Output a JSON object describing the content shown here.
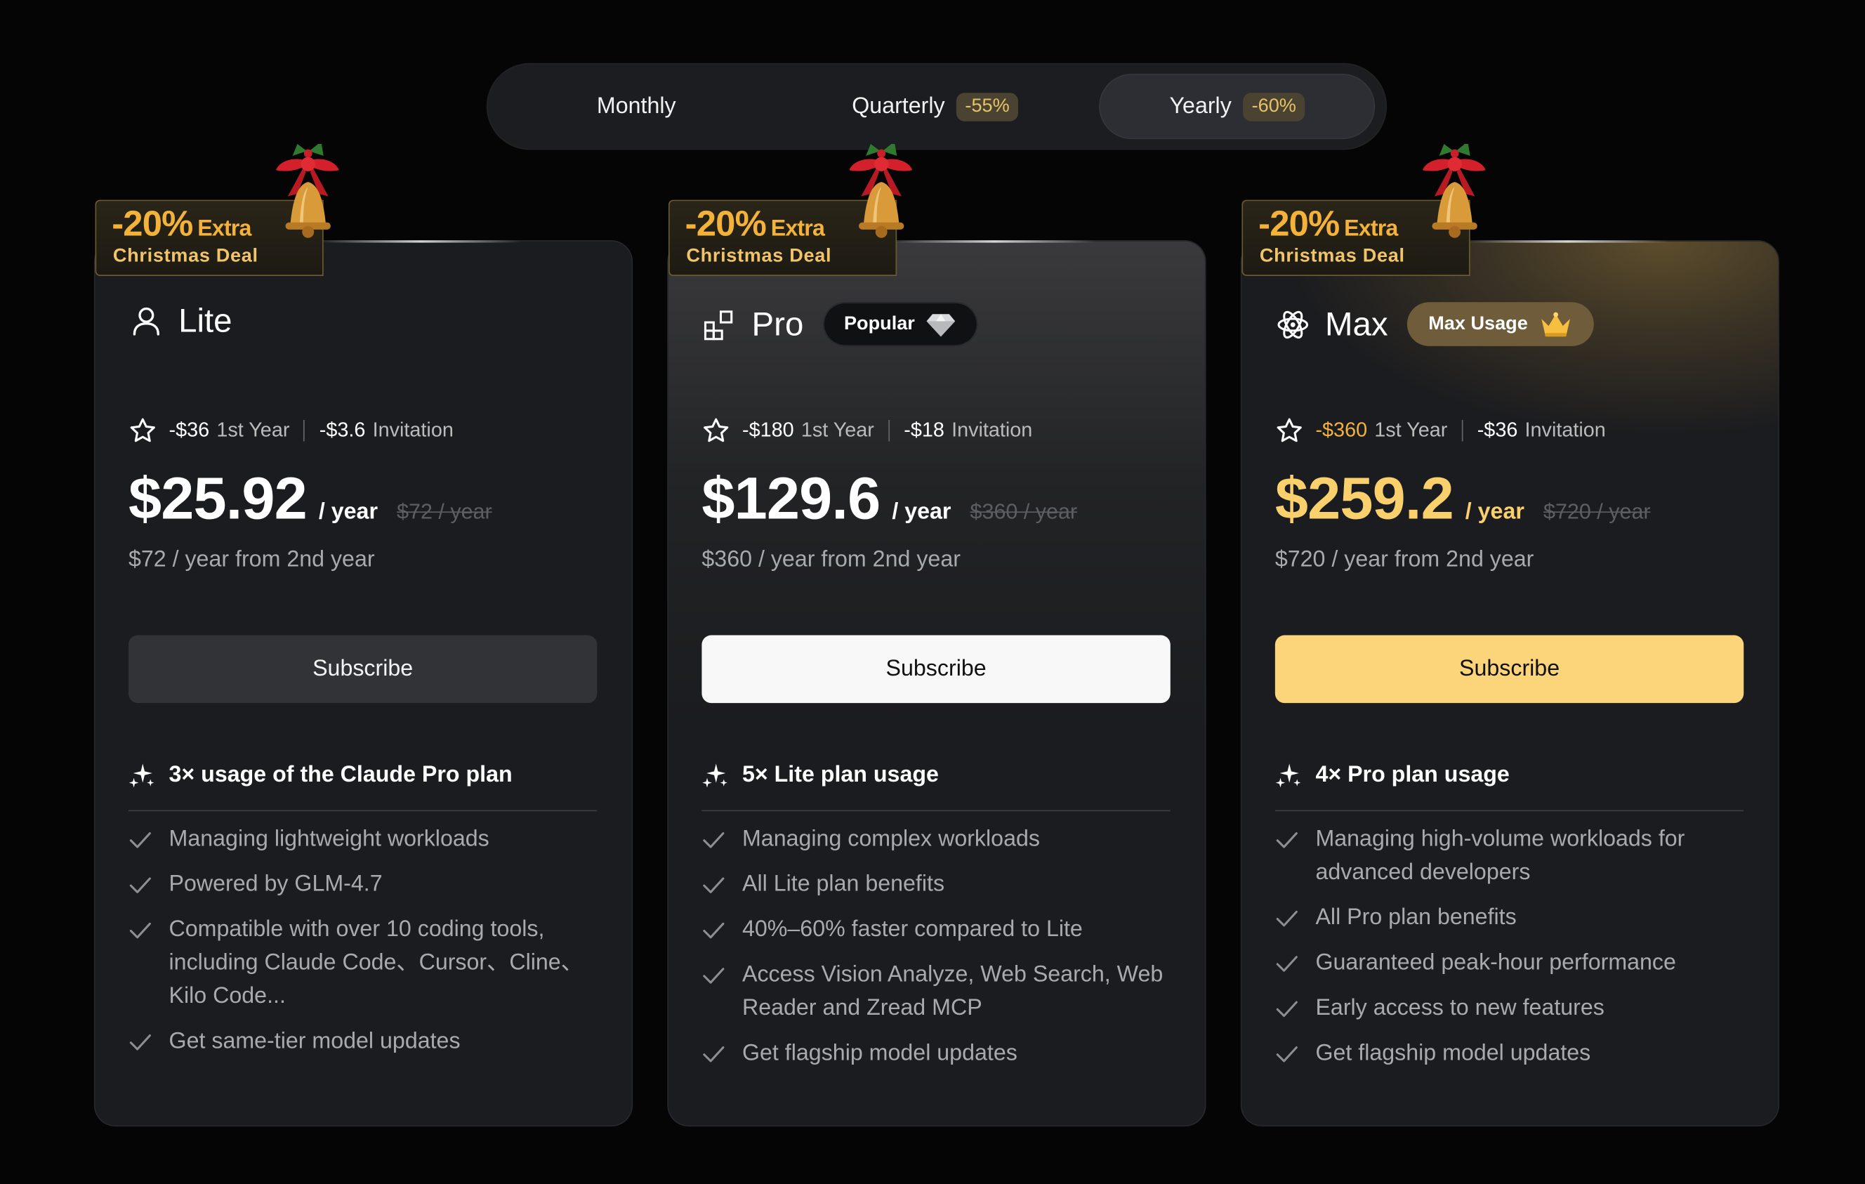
{
  "billing": {
    "monthly_label": "Monthly",
    "quarterly_label": "Quarterly",
    "quarterly_discount": "-55%",
    "yearly_label": "Yearly",
    "yearly_discount": "-60%",
    "selected": "Yearly"
  },
  "promo": {
    "percent": "-20%",
    "extra": "Extra",
    "deal": "Christmas Deal"
  },
  "colors": {
    "accent_gold": "#fcd479",
    "promo_orange": "#f3b23a",
    "card_bg": "#1b1c1f",
    "page_bg": "#050505"
  },
  "plans": [
    {
      "icon": "user-icon",
      "name": "Lite",
      "badge": "",
      "first_year_discount": "-$36",
      "first_year_label": "1st Year",
      "invitation_discount": "-$3.6",
      "invitation_label": "Invitation",
      "price": "$25.92",
      "per": "/ year",
      "old_price": "$72 / year",
      "second_year": "$72 / year from 2nd year",
      "subscribe": "Subscribe",
      "highlight": "3× usage of the Claude Pro plan",
      "features": [
        "Managing lightweight workloads",
        "Powered by GLM-4.7",
        "Compatible with over 10 coding tools, including Claude Code、Cursor、Cline、Kilo Code...",
        "Get same-tier model updates"
      ]
    },
    {
      "icon": "blocks-icon",
      "name": "Pro",
      "badge": "Popular",
      "first_year_discount": "-$180",
      "first_year_label": "1st Year",
      "invitation_discount": "-$18",
      "invitation_label": "Invitation",
      "price": "$129.6",
      "per": "/ year",
      "old_price": "$360 / year",
      "second_year": "$360 / year from 2nd year",
      "subscribe": "Subscribe",
      "highlight": "5× Lite plan usage",
      "features": [
        "Managing complex workloads",
        "All Lite plan benefits",
        "40%–60% faster compared to Lite",
        "Access Vision Analyze, Web Search, Web Reader and Zread MCP",
        "Get flagship model updates"
      ]
    },
    {
      "icon": "atom-icon",
      "name": "Max",
      "badge": "Max Usage",
      "first_year_discount": "-$360",
      "first_year_label": "1st Year",
      "invitation_discount": "-$36",
      "invitation_label": "Invitation",
      "price": "$259.2",
      "per": "/ year",
      "old_price": "$720 / year",
      "second_year": "$720 / year from 2nd year",
      "subscribe": "Subscribe",
      "highlight": "4× Pro plan usage",
      "features": [
        "Managing high-volume workloads for advanced developers",
        "All Pro plan benefits",
        "Guaranteed peak-hour performance",
        "Early access to new features",
        "Get flagship model updates"
      ]
    }
  ]
}
